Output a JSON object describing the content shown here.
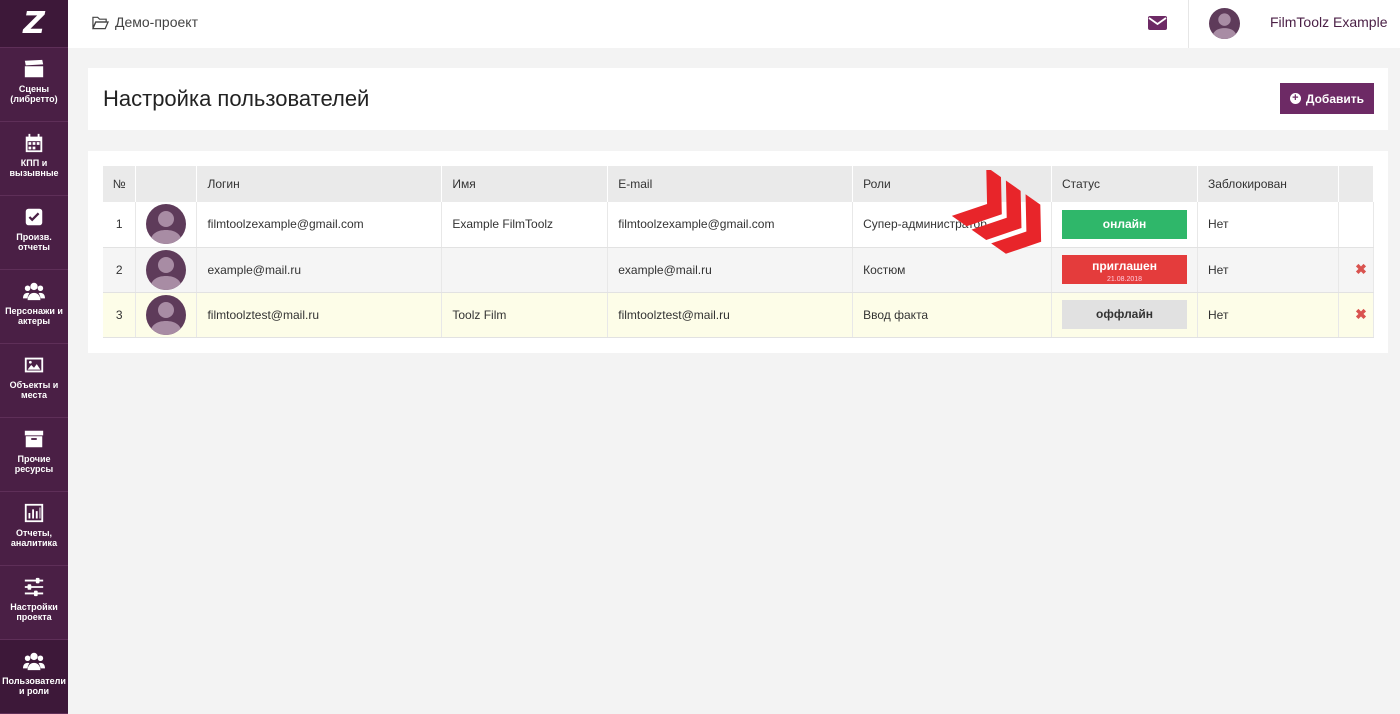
{
  "app": {
    "logo_text": "Z"
  },
  "sidebar": {
    "items": [
      {
        "label": "Сцены (либретто)",
        "icon": "clapperboard-icon"
      },
      {
        "label": "КПП и вызывные",
        "icon": "calendar-icon"
      },
      {
        "label": "Произв. отчеты",
        "icon": "checkbox-icon"
      },
      {
        "label": "Персонажи и актеры",
        "icon": "users-icon"
      },
      {
        "label": "Объекты и места",
        "icon": "image-icon"
      },
      {
        "label": "Прочие ресурсы",
        "icon": "archive-box-icon"
      },
      {
        "label": "Отчеты, аналитика",
        "icon": "bar-chart-icon"
      },
      {
        "label": "Настройки проекта",
        "icon": "sliders-icon"
      },
      {
        "label": "Пользователи и роли",
        "icon": "users-group-icon"
      }
    ]
  },
  "topbar": {
    "project_name": "Демо-проект",
    "user_name": "FilmToolz Example"
  },
  "page": {
    "title": "Настройка пользователей",
    "add_label": "Добавить"
  },
  "table": {
    "columns": [
      "№",
      "",
      "Логин",
      "Имя",
      "E-mail",
      "Роли",
      "Статус",
      "Заблокирован"
    ],
    "rows": [
      {
        "num": "1",
        "login": "filmtoolzexample@gmail.com",
        "name": "Example FilmToolz",
        "email": "filmtoolzexample@gmail.com",
        "role": "Супер-администратор",
        "status": "онлайн",
        "status_date": "",
        "blocked": "Нет",
        "delete": ""
      },
      {
        "num": "2",
        "login": "example@mail.ru",
        "name": "",
        "email": "example@mail.ru",
        "role": "Костюм",
        "status": "приглашен",
        "status_date": "21.08.2018",
        "blocked": "Нет",
        "delete": "✖"
      },
      {
        "num": "3",
        "login": "filmtoolztest@mail.ru",
        "name": "Toolz Film",
        "email": "filmtoolztest@mail.ru",
        "role": "Ввод факта",
        "status": "оффлайн",
        "status_date": "",
        "blocked": "Нет",
        "delete": "✖"
      }
    ]
  },
  "colors": {
    "sidebar": "#4a1f45",
    "accent": "#6d2a65",
    "online": "#2fb76a",
    "invited": "#e43c3c",
    "offline": "#e1e1e1"
  }
}
